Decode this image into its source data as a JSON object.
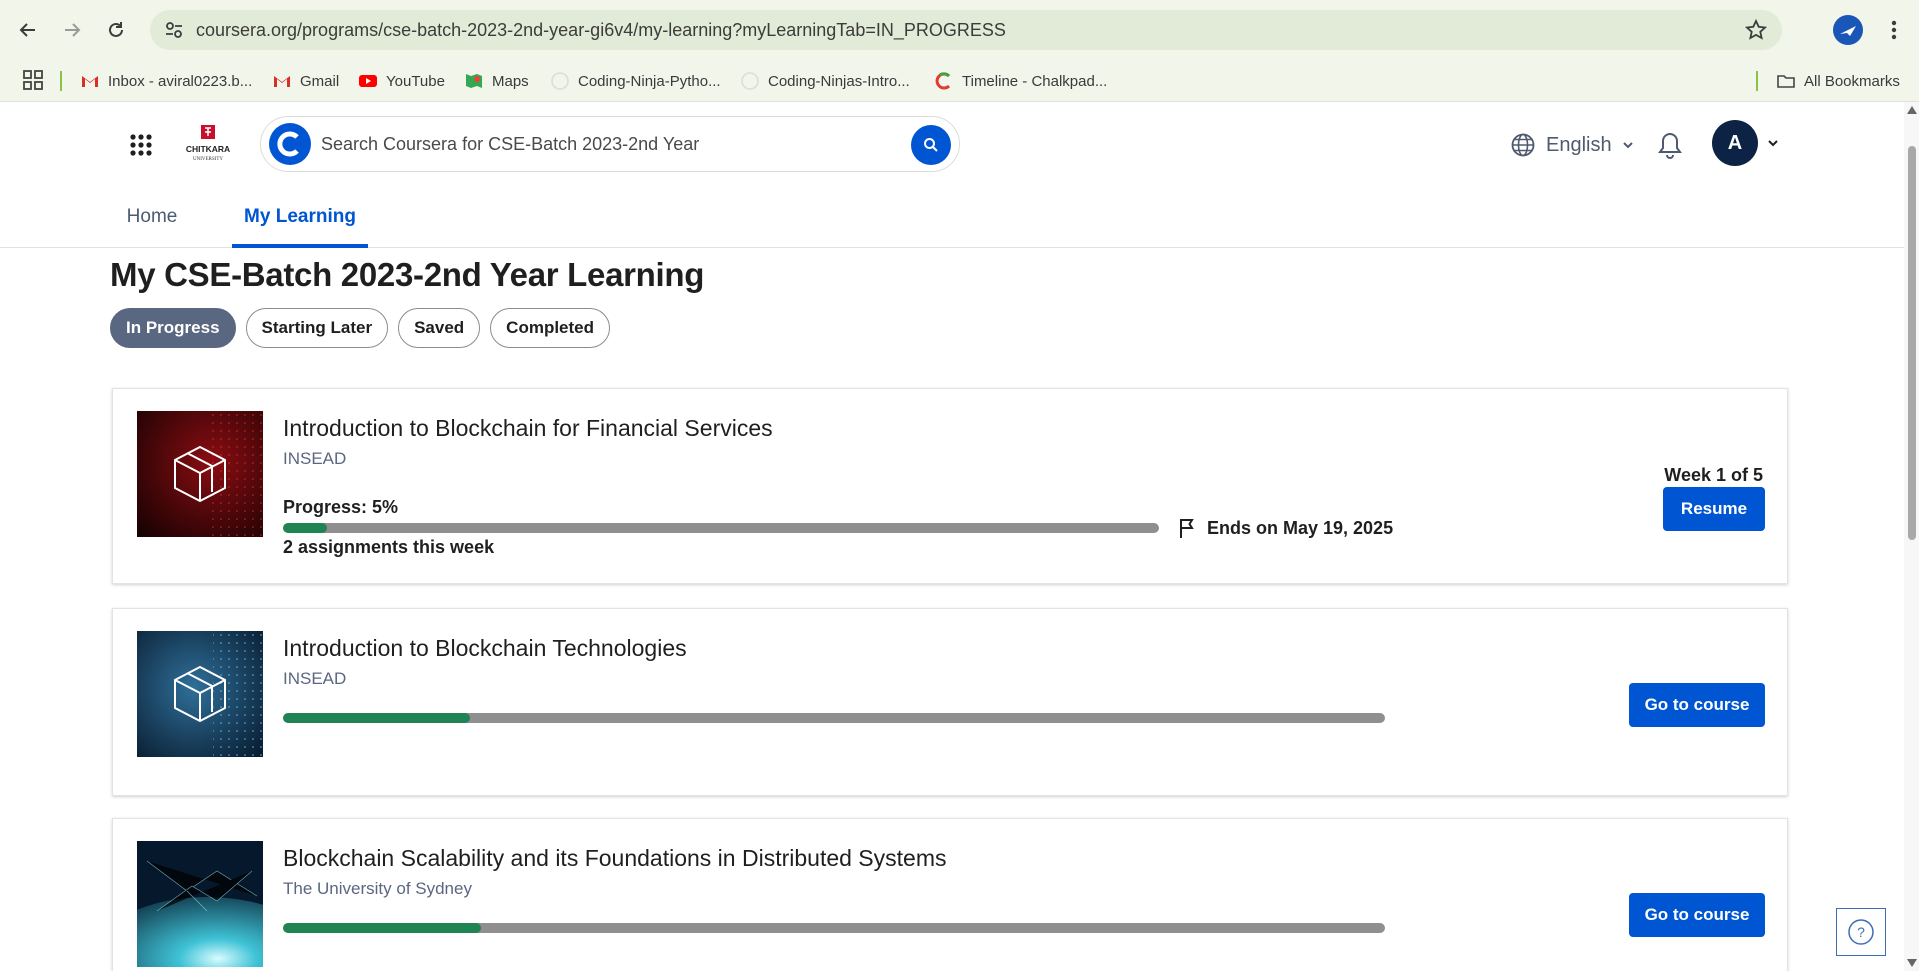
{
  "browser": {
    "url": "coursera.org/programs/cse-batch-2023-2nd-year-gi6v4/my-learning?myLearningTab=IN_PROGRESS",
    "bookmarks": [
      {
        "label": "Inbox - aviral0223.b...",
        "icon": "gmail-icon"
      },
      {
        "label": "Gmail",
        "icon": "gmail-icon"
      },
      {
        "label": "YouTube",
        "icon": "youtube-icon"
      },
      {
        "label": "Maps",
        "icon": "maps-icon"
      },
      {
        "label": "Coding-Ninja-Pytho...",
        "icon": "github-icon"
      },
      {
        "label": "Coding-Ninjas-Intro...",
        "icon": "github-icon"
      },
      {
        "label": "Timeline - Chalkpad...",
        "icon": "chalkpad-icon"
      }
    ],
    "all_bookmarks": "All Bookmarks"
  },
  "header": {
    "logo_text": "CHITKARA",
    "logo_subtext": "UNIVERSITY",
    "search_placeholder": "Search Coursera for CSE-Batch 2023-2nd Year",
    "language": "English",
    "avatar_initial": "A",
    "tabs": [
      "Home",
      "My Learning"
    ],
    "active_tab": "My Learning"
  },
  "main": {
    "title": "My CSE-Batch 2023-2nd Year Learning",
    "filters": [
      "In Progress",
      "Starting Later",
      "Saved",
      "Completed"
    ],
    "active_filter": "In Progress",
    "courses": [
      {
        "title": "Introduction to Blockchain for Financial Services",
        "partner": "INSEAD",
        "progress_label": "Progress: 5%",
        "progress": 0.05,
        "assignments": "2 assignments this week",
        "ends": "Ends on May 19, 2025",
        "week": "Week 1 of 5",
        "button": "Resume"
      },
      {
        "title": "Introduction to Blockchain Technologies",
        "partner": "INSEAD",
        "progress": 0.17,
        "button": "Go to course"
      },
      {
        "title": "Blockchain Scalability and its Foundations in Distributed Systems",
        "partner": "The University of Sydney",
        "progress": 0.18,
        "button": "Go to course"
      }
    ]
  },
  "help_label": "?",
  "colors": {
    "brand": "#0056d2",
    "progress_fill": "#1f8354",
    "progress_track": "#8f8f8f",
    "active_chip": "#5a6780"
  }
}
